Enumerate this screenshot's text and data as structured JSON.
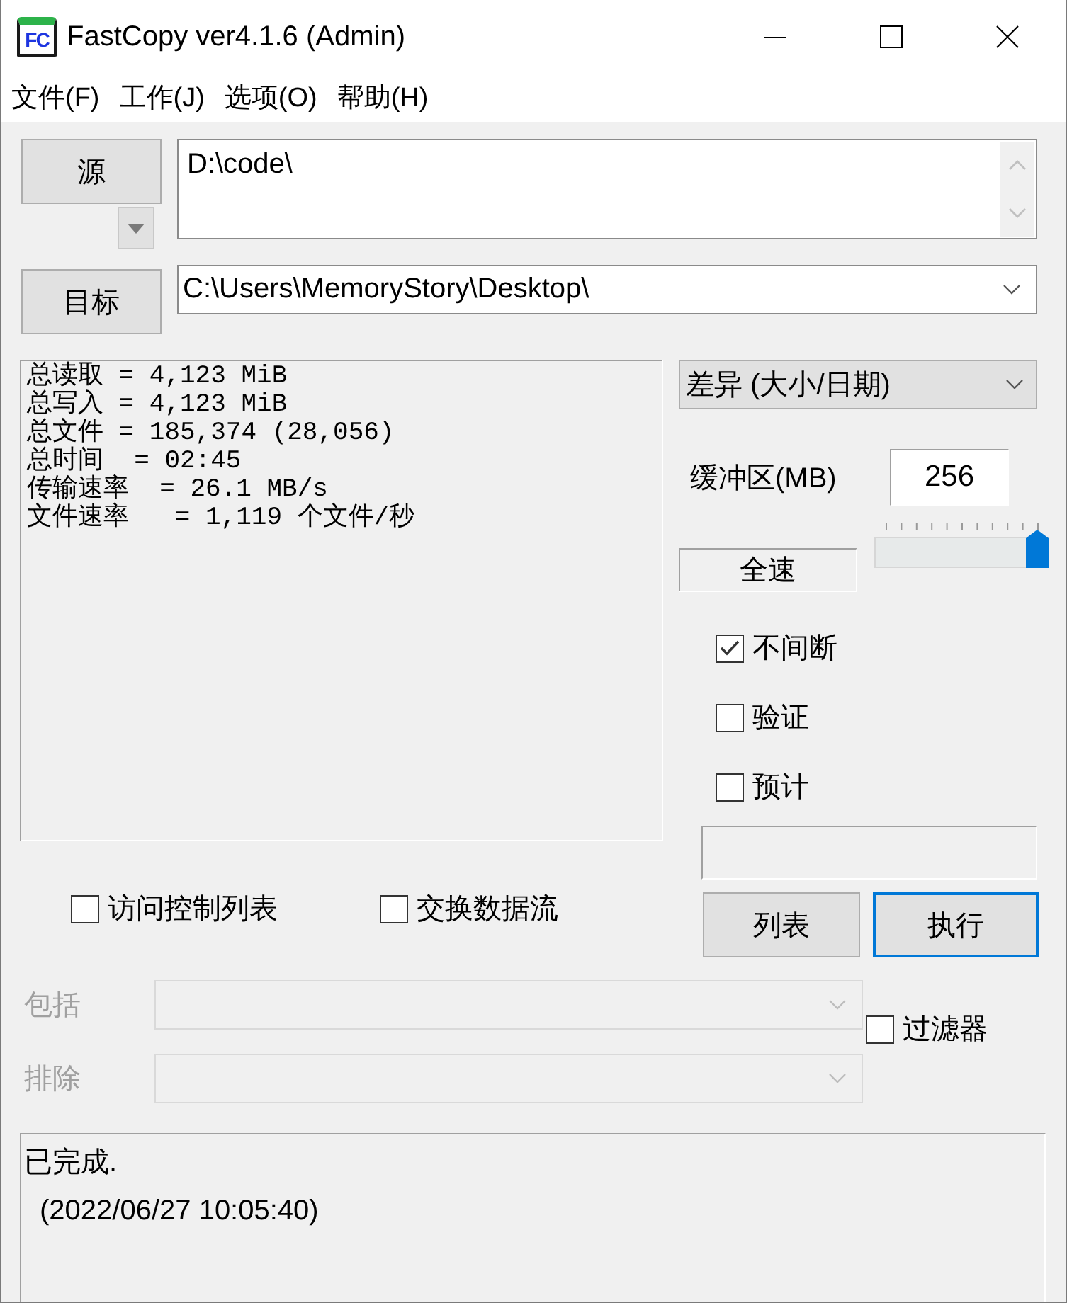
{
  "window": {
    "title": "FastCopy ver4.1.6 (Admin)",
    "logo": "FC"
  },
  "menu": [
    {
      "label": "文件(F)"
    },
    {
      "label": "工作(J)"
    },
    {
      "label": "选项(O)"
    },
    {
      "label": "帮助(H)"
    }
  ],
  "source": {
    "button": "源",
    "value": "D:\\code\\"
  },
  "target": {
    "button": "目标",
    "value": "C:\\Users\\MemoryStory\\Desktop\\"
  },
  "stats": [
    "总读取 = 4,123 MiB",
    "总写入 = 4,123 MiB",
    "总文件 = 185,374 (28,056)",
    "总时间  = 02:45",
    "传输速率  = 26.1 MB/s",
    "文件速率   = 1,119 个文件/秒"
  ],
  "mode": {
    "value": "差异 (大小/日期)"
  },
  "buffer": {
    "label": "缓冲区(MB)",
    "value": "256"
  },
  "speed": {
    "label": "全速",
    "level": 1
  },
  "options": [
    {
      "label": "不间断",
      "checked": true
    },
    {
      "label": "验证",
      "checked": false
    },
    {
      "label": "预计",
      "checked": false
    }
  ],
  "actions": [
    {
      "label": "列表",
      "focused": false
    },
    {
      "label": "执行",
      "focused": true
    }
  ],
  "extra_options": [
    {
      "label": "访问控制列表",
      "checked": false
    },
    {
      "label": "交换数据流",
      "checked": false
    }
  ],
  "filters": [
    {
      "label": "包括",
      "disabled": true
    },
    {
      "label": "排除",
      "disabled": true
    }
  ],
  "filter_toggle": {
    "label": "过滤器",
    "checked": false
  },
  "status": [
    "已完成.",
    "(2022/06/27 10:05:40)"
  ]
}
